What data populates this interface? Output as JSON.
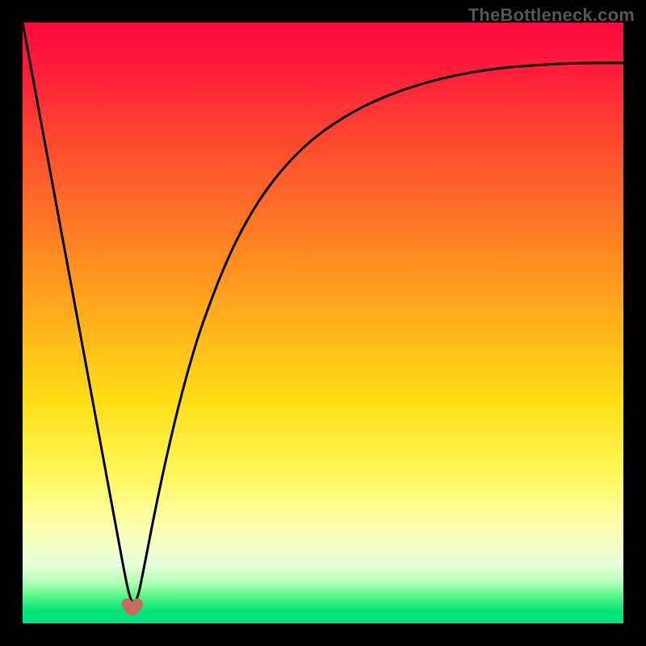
{
  "watermark": "TheBottleneck.com",
  "gradient_stops": [
    {
      "offset": 0.0,
      "color": "#ff0a3f"
    },
    {
      "offset": 0.08,
      "color": "#ff1d3a"
    },
    {
      "offset": 0.2,
      "color": "#ff4a2f"
    },
    {
      "offset": 0.35,
      "color": "#ff7d24"
    },
    {
      "offset": 0.5,
      "color": "#ffb21a"
    },
    {
      "offset": 0.63,
      "color": "#ffde14"
    },
    {
      "offset": 0.75,
      "color": "#fff75a"
    },
    {
      "offset": 0.84,
      "color": "#fdffb0"
    },
    {
      "offset": 0.9,
      "color": "#e8ffdc"
    },
    {
      "offset": 0.93,
      "color": "#b7ffba"
    },
    {
      "offset": 0.955,
      "color": "#57f788"
    },
    {
      "offset": 0.98,
      "color": "#00e37a"
    },
    {
      "offset": 1.0,
      "color": "#00e37a"
    }
  ],
  "marker_color": "#c86a60",
  "curve_color": "#000000",
  "chart_data": {
    "type": "line",
    "title": "",
    "xlabel": "",
    "ylabel": "",
    "ylim": [
      0,
      100
    ],
    "x": [
      0.0,
      0.02,
      0.04,
      0.06,
      0.08,
      0.1,
      0.12,
      0.14,
      0.16,
      0.17,
      0.18,
      0.19,
      0.2,
      0.22,
      0.24,
      0.26,
      0.28,
      0.3,
      0.34,
      0.38,
      0.42,
      0.46,
      0.5,
      0.55,
      0.6,
      0.65,
      0.7,
      0.75,
      0.8,
      0.85,
      0.9,
      0.95,
      1.0
    ],
    "y": [
      100,
      89.2,
      78.4,
      67.6,
      56.8,
      46.0,
      35.2,
      24.4,
      13.6,
      8.2,
      3.5,
      3.5,
      8.2,
      18.6,
      28.0,
      36.4,
      43.8,
      50.2,
      60.6,
      68.4,
      74.2,
      78.6,
      82.0,
      85.2,
      87.6,
      89.4,
      90.8,
      91.8,
      92.5,
      92.9,
      93.2,
      93.3,
      93.3
    ],
    "bottom_markers_x": [
      0.174,
      0.191
    ]
  }
}
